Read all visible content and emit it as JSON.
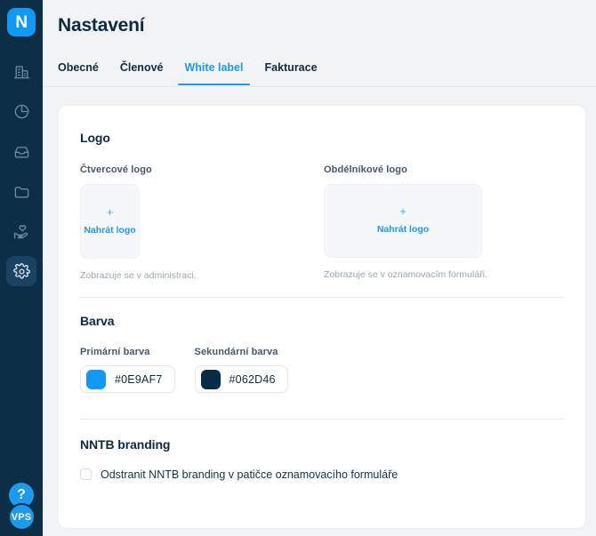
{
  "sidebar": {
    "brand": {
      "label": "N",
      "color": "#0e9af7"
    },
    "items": [
      {
        "name": "organization",
        "icon": "building-icon"
      },
      {
        "name": "statistics",
        "icon": "pie-chart-icon"
      },
      {
        "name": "inbox",
        "icon": "inbox-icon"
      },
      {
        "name": "files",
        "icon": "folder-icon"
      },
      {
        "name": "donations",
        "icon": "hand-heart-icon"
      },
      {
        "name": "settings",
        "icon": "gear-icon",
        "active": true
      }
    ],
    "help_label": "?",
    "avatar_label": "VPS"
  },
  "header": {
    "title": "Nastavení",
    "tabs": [
      {
        "label": "Obecné",
        "active": false
      },
      {
        "label": "Členové",
        "active": false
      },
      {
        "label": "White label",
        "active": true
      },
      {
        "label": "Fakturace",
        "active": false
      }
    ]
  },
  "logo_section": {
    "title": "Logo",
    "square": {
      "label": "Čtvercové logo",
      "upload_plus": "+",
      "upload_text": "Nahrát logo",
      "helper": "Zobrazuje se v administraci."
    },
    "rectangle": {
      "label": "Obdélníkové logo",
      "upload_plus": "+",
      "upload_text": "Nahrát logo",
      "helper": "Zobrazuje se v oznamovacím formuláři."
    }
  },
  "color_section": {
    "title": "Barva",
    "primary": {
      "label": "Primární barva",
      "value": "#0E9AF7",
      "swatch": "#0E9AF7"
    },
    "secondary": {
      "label": "Sekundární barva",
      "value": "#062D46",
      "swatch": "#062D46"
    }
  },
  "branding_section": {
    "title": "NNTB branding",
    "checkbox_label": "Odstranit NNTB branding v patičce oznamovacího formuláře",
    "checked": false
  }
}
